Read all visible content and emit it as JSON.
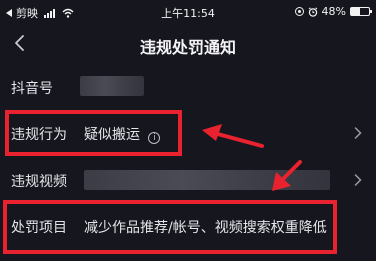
{
  "status_bar": {
    "carrier": "剪映",
    "time": "上午11:54",
    "battery": "48%",
    "battery_level": 0.48
  },
  "nav": {
    "title": "违规处罚通知"
  },
  "rows": {
    "account": {
      "label": "抖音号"
    },
    "violation": {
      "label": "违规行为",
      "value": "疑似搬运",
      "info_symbol": "i"
    },
    "video": {
      "label": "违规视频"
    },
    "penalty": {
      "label": "处罚项目",
      "value": "减少作品推荐/帐号、视频搜索权重降低"
    }
  },
  "colors": {
    "background": "#15161e",
    "highlight": "#e8232f"
  },
  "icons": {
    "back": "chevron-left-icon",
    "row_more": "chevron-right-icon",
    "info": "info-circle-icon"
  }
}
